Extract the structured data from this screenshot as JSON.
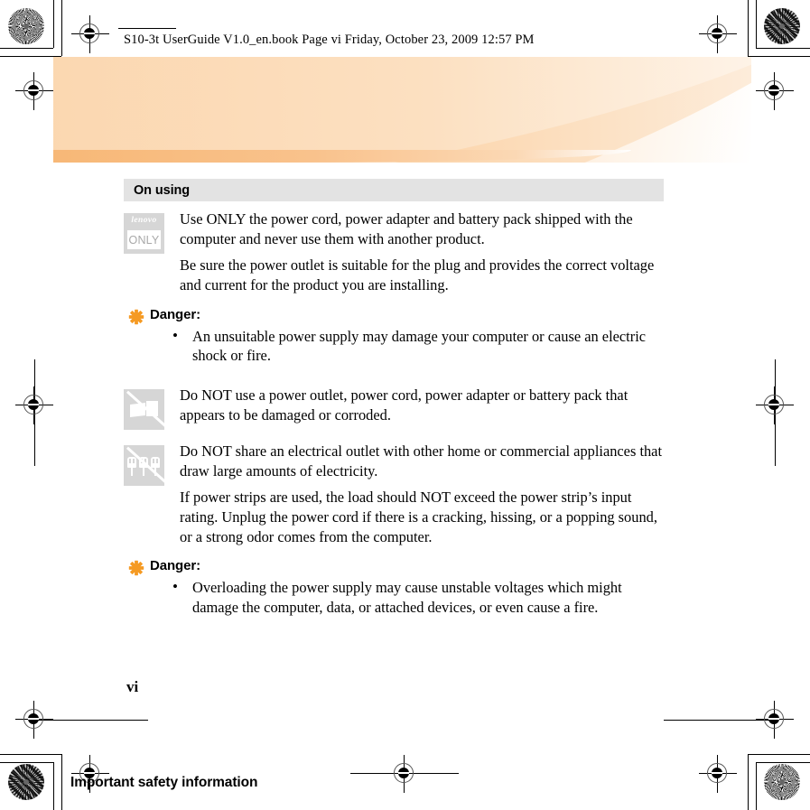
{
  "page": {
    "file_header": "S10-3t UserGuide V1.0_en.book  Page vi  Friday, October 23, 2009  12:57 PM",
    "banner_title": "Important safety information",
    "page_number": "vi",
    "accent_color": "#f59a23",
    "banner_color": "#fbd5ab",
    "section_bar_color": "#e3e3e3",
    "icon_color": "#d6d6d6"
  },
  "section": {
    "heading": "On using"
  },
  "icons": {
    "lenovo_only": {
      "name": "lenovo-only-icon",
      "brand_text": "lenovo",
      "label_text": "ONLY"
    },
    "no_damaged_adapter": {
      "name": "no-damaged-adapter-icon"
    },
    "no_shared_outlet": {
      "name": "no-shared-outlet-icon"
    },
    "danger_star": {
      "name": "danger-star-icon"
    }
  },
  "blocks": [
    {
      "icon": "lenovo-only-icon",
      "paragraphs": [
        "Use ONLY the power cord, power adapter and battery pack shipped with the computer and never use them with another product.",
        "Be sure the power outlet is suitable for the plug and provides the correct voltage and current for the product you are installing."
      ]
    },
    {
      "icon": "no-damaged-adapter-icon",
      "paragraphs": [
        "Do NOT use a power outlet, power cord, power adapter or battery pack that appears to be damaged or corroded."
      ]
    },
    {
      "icon": "no-shared-outlet-icon",
      "paragraphs": [
        "Do NOT share an electrical outlet with other home or commercial appliances that draw large amounts of electricity.",
        "If power strips are used, the load should NOT exceed the power strip’s input rating. Unplug the power cord if there is a cracking, hissing, or a popping sound, or a strong odor comes from the computer."
      ]
    }
  ],
  "danger_blocks": [
    {
      "label": "Danger:",
      "bullets": [
        "An unsuitable power supply may damage your computer or cause an electric shock or fire."
      ]
    },
    {
      "label": "Danger:",
      "bullets": [
        "Overloading the power supply may cause unstable voltages which might damage the computer, data, or attached devices, or even cause a fire."
      ]
    }
  ]
}
